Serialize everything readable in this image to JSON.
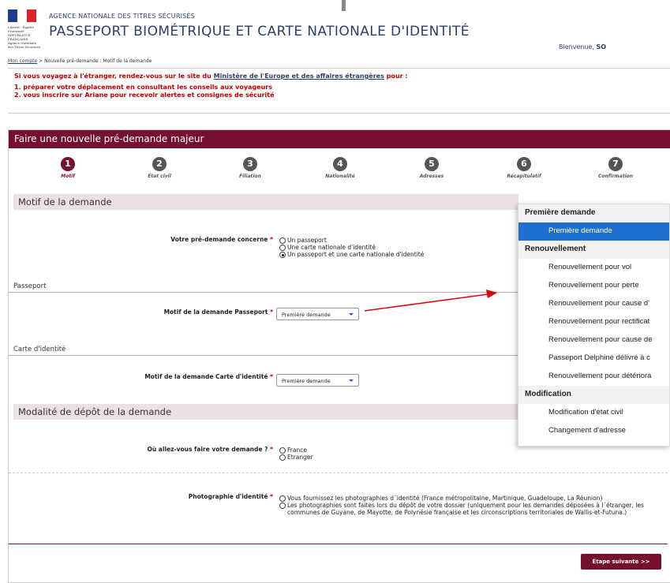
{
  "header": {
    "logo_lines": [
      "Liberté · Égalité · Fraternité",
      "RÉPUBLIQUE FRANÇAISE",
      "Agence Nationale",
      "des Titres Sécurisés"
    ],
    "agency_small": "AGENCE NATIONALE DES TITRES SÉCURISÉS",
    "agency_title": "PASSEPORT BIOMÉTRIQUE ET CARTE NATIONALE D'IDENTITÉ",
    "welcome": "Bienvenue,",
    "user": "SO"
  },
  "breadcrumb": {
    "link": "Mon compte",
    "sep": ">",
    "rest": "Nouvelle pré-demande : Motif de la demande"
  },
  "warning": {
    "line1_prefix": "Si vous voyagez à l'étranger, rendez-vous sur le site du",
    "line1_link": "Ministère de l'Europe et des affaires étrangères",
    "line1_suffix": "pour :",
    "item1": "1. préparer votre déplacement en consultant les conseils aux voyageurs",
    "item2": "2. vous inscrire sur Ariane pour recevoir alertes et consignes de sécurité"
  },
  "card": {
    "title": "Faire une nouvelle pré-demande majeur",
    "steps": [
      {
        "num": "1",
        "label": "Motif"
      },
      {
        "num": "2",
        "label": "État civil"
      },
      {
        "num": "3",
        "label": "Filiation"
      },
      {
        "num": "4",
        "label": "Nationalité"
      },
      {
        "num": "5",
        "label": "Adresses"
      },
      {
        "num": "6",
        "label": "Récapitulatif"
      },
      {
        "num": "7",
        "label": "Confirmation"
      }
    ],
    "section_motif": "Motif de la demande",
    "concerne_label": "Votre pré-demande concerne",
    "concerne_options": [
      "Un passeport",
      "Une carte nationale d'identité",
      "Un passeport et une carte nationale d'identité"
    ],
    "sub_passeport": "Passeport",
    "motif_passeport_label": "Motif de la demande Passeport",
    "motif_passeport_value": "Première demande",
    "sub_carte": "Carte d'identité",
    "motif_carte_label": "Motif de la demande Carte d'identité",
    "motif_carte_value": "Première demande",
    "section_depot": "Modalité de dépôt de la demande",
    "ou_label": "Où allez-vous faire votre demande ?",
    "ou_options": [
      "France",
      "Etranger"
    ],
    "photo_label": "Photographie d'identité",
    "photo_option1": "Vous fournissez les photographies d´identité (France métropolitaine, Martinique, Guadeloupe, La Réunion)",
    "photo_option2": "Les photographies sont faites lors du dépôt de votre dossier (uniquement pour les demandes déposées à l´étranger, les communes de Guyane, de Mayotte, de Polynésie française et les circonscriptions territoriales de Wallis-et-Futuna.)",
    "required_mark": "*",
    "next_button": "Étape suivante >>"
  },
  "dropdown": {
    "group1": "Première demande",
    "group1_items": [
      "Première demande"
    ],
    "group2": "Renouvellement",
    "group2_items": [
      "Renouvellement pour vol",
      "Renouvellement pour perte",
      "Renouvellement pour cause d'",
      "Renouvellement pour rectificat",
      "Renouvellement pour cause de",
      "Passeport Delphine délivré à c",
      "Renouvellement pour détériora"
    ],
    "group3": "Modification",
    "group3_items": [
      "Modification d'état civil",
      "Changement d'adresse"
    ]
  },
  "colors": {
    "brand": "#76102f",
    "selected": "#1e6fce",
    "warning": "#c00000",
    "annotation_arrow": "#e00000"
  }
}
